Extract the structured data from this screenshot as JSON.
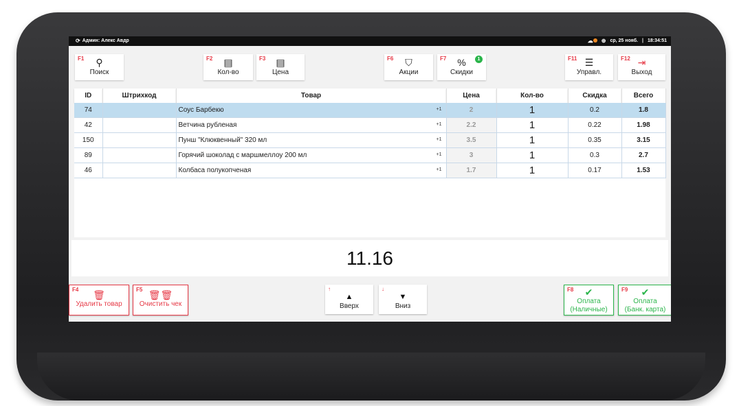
{
  "status_bar": {
    "user": "Админ: Алекс Авдр",
    "date": "ср, 25 нояб.",
    "separator": "|",
    "time": "18:34:51"
  },
  "toolbar": {
    "search": {
      "key": "F1",
      "label": "Поиск",
      "icon": "search-icon"
    },
    "qty": {
      "key": "F2",
      "label": "Кол-во",
      "icon": "quantity-icon"
    },
    "price": {
      "key": "F3",
      "label": "Цена",
      "icon": "price-icon"
    },
    "promos": {
      "key": "F6",
      "label": "Акции",
      "icon": "bag-icon"
    },
    "discounts": {
      "key": "F7",
      "label": "Скидки",
      "icon": "percent-icon",
      "badge": "1"
    },
    "manage": {
      "key": "F11",
      "label": "Управл.",
      "icon": "menu-icon"
    },
    "exit": {
      "key": "F12",
      "label": "Выход",
      "icon": "exit-icon"
    }
  },
  "table": {
    "headers": [
      "ID",
      "Штрихкод",
      "Товар",
      "Цена",
      "Кол-во",
      "Скидка",
      "Всего"
    ],
    "rows": [
      {
        "id": "74",
        "barcode": "",
        "name": "Соус Барбекю",
        "plus": "+1",
        "price": "2",
        "qty": "1",
        "discount": "0.2",
        "total": "1.8",
        "selected": true
      },
      {
        "id": "42",
        "barcode": "",
        "name": "Ветчина рубленая",
        "plus": "+1",
        "price": "2.2",
        "qty": "1",
        "discount": "0.22",
        "total": "1.98",
        "selected": false
      },
      {
        "id": "150",
        "barcode": "",
        "name": "Пунш \"Клюквенный\" 320 мл",
        "plus": "+1",
        "price": "3.5",
        "qty": "1",
        "discount": "0.35",
        "total": "3.15",
        "selected": false
      },
      {
        "id": "89",
        "barcode": "",
        "name": "Горячий шоколад с маршмеллоу 200 мл",
        "plus": "+1",
        "price": "3",
        "qty": "1",
        "discount": "0.3",
        "total": "2.7",
        "selected": false
      },
      {
        "id": "46",
        "barcode": "",
        "name": "Колбаса полукопченая",
        "plus": "+1",
        "price": "1.7",
        "qty": "1",
        "discount": "0.17",
        "total": "1.53",
        "selected": false
      }
    ]
  },
  "total": "11.16",
  "actions": {
    "delete_item": {
      "key": "F4",
      "label": "Удалить товар",
      "icon": "trash-icon"
    },
    "clear_check": {
      "key": "F5",
      "label": "Очистить чек",
      "icon": "trash-double-icon"
    },
    "up": {
      "key": "↑",
      "label": "Вверх",
      "icon": "triangle-up-icon"
    },
    "down": {
      "key": "↓",
      "label": "Вниз",
      "icon": "triangle-down-icon"
    },
    "pay_cash": {
      "key": "F8",
      "label_1": "Оплата",
      "label_2": "(Наличные)",
      "icon": "check-icon"
    },
    "pay_card": {
      "key": "F9",
      "label_1": "Оплата",
      "label_2": "(Банк. карта)",
      "icon": "check-icon"
    }
  },
  "colors": {
    "accent_red": "#e63946",
    "accent_green": "#2bb54b",
    "selected_row": "#bfdcef"
  }
}
